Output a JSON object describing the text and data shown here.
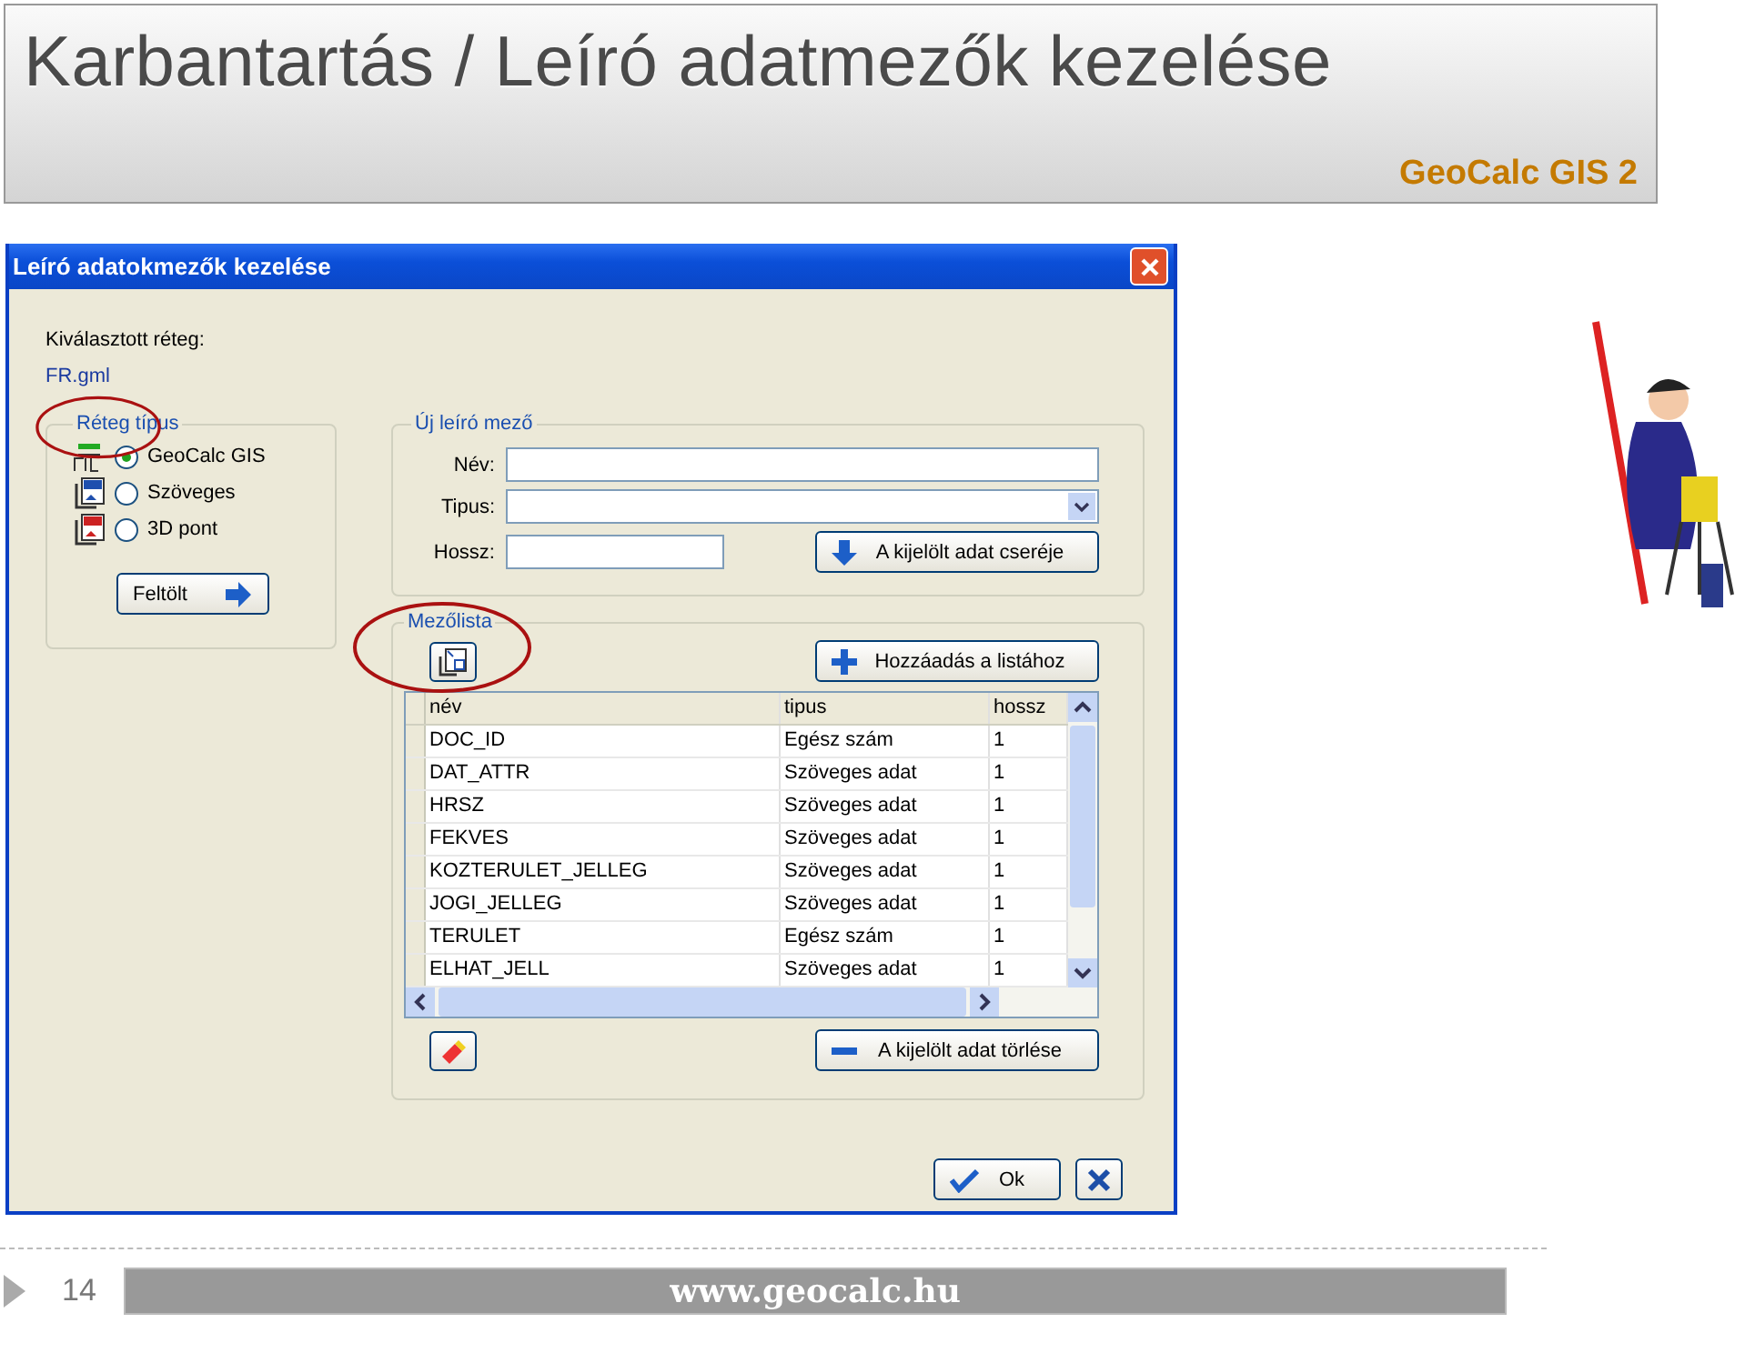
{
  "slide": {
    "title": "Karbantartás / Leíró adatmezők kezelése",
    "brand": "GeoCalc GIS 2"
  },
  "dialog": {
    "title": "Leíró adatokmezők kezelése",
    "layer_label": "Kiválasztott réteg:",
    "layer_value": "FR.gml",
    "layer_type": {
      "legend": "Réteg típus",
      "options": [
        {
          "kind": "gis",
          "label": "GeoCalc GIS",
          "selected": true
        },
        {
          "kind": "txt",
          "label": "Szöveges",
          "selected": false
        },
        {
          "kind": "point",
          "label": "3D pont",
          "selected": false
        }
      ],
      "upload_button": "Feltölt"
    },
    "new_field": {
      "legend": "Új leíró mező",
      "fields": [
        {
          "kind": "text",
          "label": "Név:"
        },
        {
          "kind": "select",
          "label": "Tipus:"
        },
        {
          "kind": "short",
          "label": "Hossz:"
        }
      ],
      "replace_button": "A kijelölt adat cseréje"
    },
    "field_list": {
      "legend": "Mezőlista",
      "add_button": "Hozzáadás a listához",
      "table": {
        "columns": [
          "név",
          "tipus",
          "hossz"
        ],
        "rows": [
          [
            "DOC_ID",
            "Egész szám",
            "1"
          ],
          [
            "DAT_ATTR",
            "Szöveges adat",
            "1"
          ],
          [
            "HRSZ",
            "Szöveges adat",
            "1"
          ],
          [
            "FEKVES",
            "Szöveges adat",
            "1"
          ],
          [
            "KOZTERULET_JELLEG",
            "Szöveges adat",
            "1"
          ],
          [
            "JOGI_JELLEG",
            "Szöveges adat",
            "1"
          ],
          [
            "TERULET",
            "Egész szám",
            "1"
          ],
          [
            "ELHAT_JELL",
            "Szöveges adat",
            "1"
          ]
        ]
      },
      "delete_button": "A kijelölt adat törlése"
    },
    "ok_button": "Ok"
  },
  "footer": {
    "page_number": "14",
    "url": "www.geocalc.hu"
  }
}
